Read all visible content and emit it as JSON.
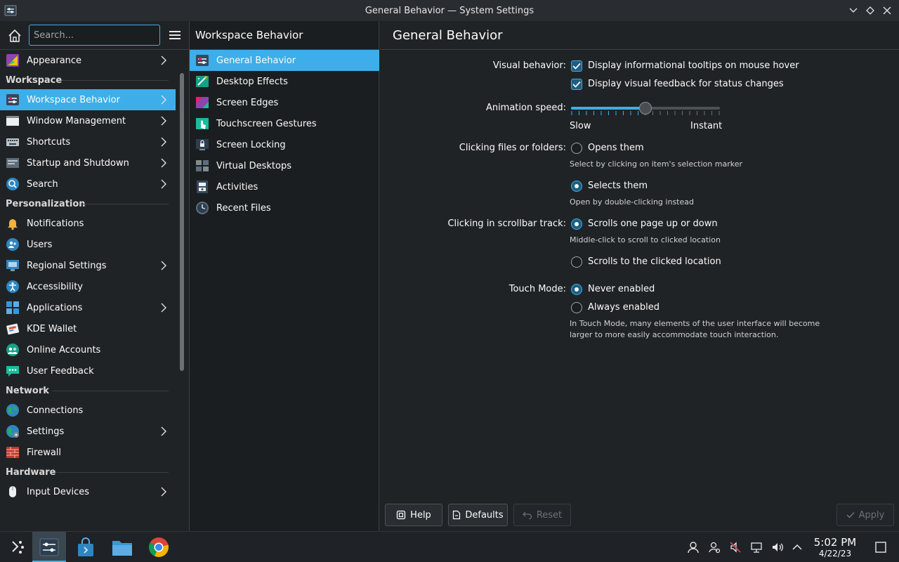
{
  "window": {
    "title": "General Behavior — System Settings"
  },
  "sidebar": {
    "search_placeholder": "Search...",
    "items": [
      {
        "type": "item",
        "label": "Appearance",
        "icon": "appearance-icon",
        "chevron": true
      },
      {
        "type": "section",
        "label": "Workspace"
      },
      {
        "type": "item",
        "label": "Workspace Behavior",
        "icon": "workspace-behavior-icon",
        "chevron": true,
        "active": true
      },
      {
        "type": "item",
        "label": "Window Management",
        "icon": "window-management-icon",
        "chevron": true
      },
      {
        "type": "item",
        "label": "Shortcuts",
        "icon": "keyboard-icon",
        "chevron": true
      },
      {
        "type": "item",
        "label": "Startup and Shutdown",
        "icon": "startup-icon",
        "chevron": true
      },
      {
        "type": "item",
        "label": "Search",
        "icon": "search-icon",
        "chevron": true
      },
      {
        "type": "section",
        "label": "Personalization"
      },
      {
        "type": "item",
        "label": "Notifications",
        "icon": "bell-icon"
      },
      {
        "type": "item",
        "label": "Users",
        "icon": "users-icon"
      },
      {
        "type": "item",
        "label": "Regional Settings",
        "icon": "regional-icon",
        "chevron": true
      },
      {
        "type": "item",
        "label": "Accessibility",
        "icon": "accessibility-icon"
      },
      {
        "type": "item",
        "label": "Applications",
        "icon": "applications-icon",
        "chevron": true
      },
      {
        "type": "item",
        "label": "KDE Wallet",
        "icon": "wallet-icon"
      },
      {
        "type": "item",
        "label": "Online Accounts",
        "icon": "online-accounts-icon"
      },
      {
        "type": "item",
        "label": "User Feedback",
        "icon": "feedback-icon"
      },
      {
        "type": "section",
        "label": "Network"
      },
      {
        "type": "item",
        "label": "Connections",
        "icon": "globe-icon"
      },
      {
        "type": "item",
        "label": "Settings",
        "icon": "globe-settings-icon",
        "chevron": true
      },
      {
        "type": "item",
        "label": "Firewall",
        "icon": "firewall-icon"
      },
      {
        "type": "section",
        "label": "Hardware"
      },
      {
        "type": "item",
        "label": "Input Devices",
        "icon": "mouse-icon",
        "chevron": true
      }
    ]
  },
  "subpanel": {
    "title": "Workspace Behavior",
    "items": [
      {
        "label": "General Behavior",
        "icon": "general-behavior-icon",
        "active": true
      },
      {
        "label": "Desktop Effects",
        "icon": "desktop-effects-icon"
      },
      {
        "label": "Screen Edges",
        "icon": "screen-edges-icon"
      },
      {
        "label": "Touchscreen Gestures",
        "icon": "touch-gestures-icon"
      },
      {
        "label": "Screen Locking",
        "icon": "screen-locking-icon"
      },
      {
        "label": "Virtual Desktops",
        "icon": "virtual-desktops-icon"
      },
      {
        "label": "Activities",
        "icon": "activities-icon"
      },
      {
        "label": "Recent Files",
        "icon": "recent-files-icon"
      }
    ]
  },
  "main": {
    "title": "General Behavior",
    "visual_behavior": {
      "label": "Visual behavior:",
      "tooltips": "Display informational tooltips on mouse hover",
      "feedback": "Display visual feedback for status changes",
      "tooltips_checked": true,
      "feedback_checked": true
    },
    "animation": {
      "label": "Animation speed:",
      "slow": "Slow",
      "instant": "Instant",
      "value_fraction": 0.5
    },
    "clicking": {
      "label": "Clicking files or folders:",
      "opens": "Opens them",
      "opens_hint": "Select by clicking on item's selection marker",
      "selects": "Selects them",
      "selects_hint": "Open by double-clicking instead",
      "selected": "selects"
    },
    "scrollbar": {
      "label": "Clicking in scrollbar track:",
      "page": "Scrolls one page up or down",
      "page_hint": "Middle-click to scroll to clicked location",
      "location": "Scrolls to the clicked location",
      "selected": "page"
    },
    "touch": {
      "label": "Touch Mode:",
      "never": "Never enabled",
      "always": "Always enabled",
      "hint_line1": "In Touch Mode, many elements of the user interface will become",
      "hint_line2": "larger to more easily accommodate touch interaction.",
      "selected": "never"
    },
    "footer": {
      "help": "Help",
      "defaults": "Defaults",
      "reset": "Reset",
      "apply": "Apply"
    }
  },
  "taskbar": {
    "time": "5:02 PM",
    "date": "4/22/23"
  },
  "colors": {
    "accent": "#3daee9",
    "background": "#202326"
  }
}
